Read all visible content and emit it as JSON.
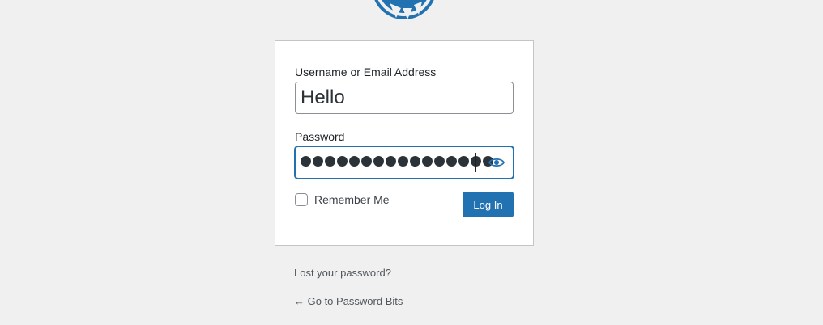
{
  "form": {
    "username_label": "Username or Email Address",
    "username_value": "Hello",
    "password_label": "Password",
    "password_mask_count": 16,
    "remember_label": "Remember Me",
    "login_button": "Log In"
  },
  "links": {
    "lost_password": "Lost your password?",
    "back_to_site": "← Go to Password Bits"
  },
  "colors": {
    "primary": "#2271b1",
    "background": "#f0f0f1"
  },
  "icons": {
    "logo": "wordpress-logo-icon",
    "show_password": "eye-icon"
  }
}
